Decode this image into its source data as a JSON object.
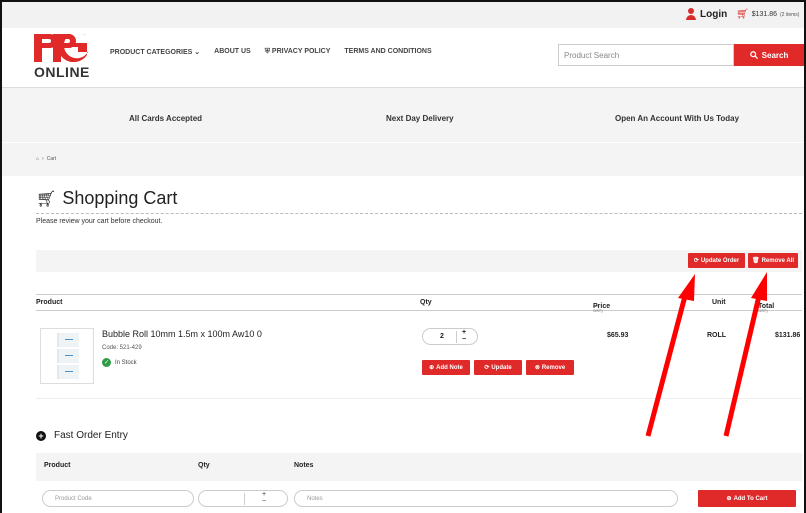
{
  "topbar": {
    "login_label": "Login",
    "cart_total": "$131.86",
    "cart_items": "(2 items)"
  },
  "header": {
    "logo_text": "PPG",
    "logo_sub": "ONLINE",
    "nav": [
      "PRODUCT CATEGORIES ⌄",
      "ABOUT US",
      "⛨ PRIVACY POLICY",
      "TERMS AND CONDITIONS"
    ],
    "search_placeholder": "Product Search",
    "search_button": "Search"
  },
  "band": {
    "features": [
      "All Cards Accepted",
      "Next Day Delivery",
      "Open An Account With Us Today"
    ],
    "breadcrumb": [
      "Cart"
    ]
  },
  "cart": {
    "title": "Shopping Cart",
    "subtitle": "Please review your cart before checkout.",
    "update_order": "Update Order",
    "remove_all": "Remove All",
    "columns": {
      "product": "Product",
      "qty": "Qty",
      "price": "Price",
      "price_sub": "(ex GST)",
      "unit": "Unit",
      "total": "Total",
      "total_sub": "(ex GST)"
    },
    "item": {
      "name": "Bubble Roll 10mm 1.5m x 100m Aw10 0",
      "code": "Code: 521-429",
      "stock": "In Stock",
      "qty": "2",
      "price": "$65.93",
      "unit": "ROLL",
      "total": "$131.86",
      "add_note": "Add Note",
      "update": "Update",
      "remove": "Remove"
    }
  },
  "fast_order": {
    "title": "Fast Order Entry",
    "col_product": "Product",
    "col_qty": "Qty",
    "col_notes": "Notes",
    "code_placeholder": "Product Code",
    "notes_placeholder": "Notes",
    "add_to_cart": "Add To Cart"
  },
  "colors": {
    "brand_red": "#e02a2a",
    "annotation_arrow": "#ff0000",
    "stock_green": "#2e9b46"
  }
}
